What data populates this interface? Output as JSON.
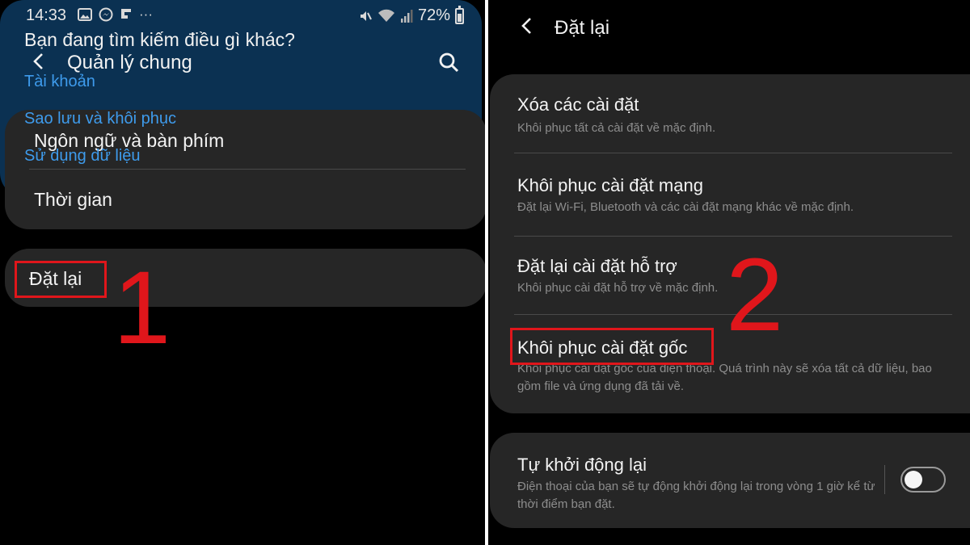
{
  "left": {
    "status_bar": {
      "time": "14:33",
      "battery": "72%",
      "battery_level": 0.72,
      "icons": [
        "gallery-icon",
        "messenger-icon",
        "flipboard-icon",
        "more-dots-icon",
        "mute-icon",
        "wifi-icon",
        "signal-icon",
        "battery-icon"
      ]
    },
    "header": {
      "title": "Quản lý chung"
    },
    "general_card": {
      "items": [
        {
          "label": "Ngôn ngữ và bàn phím"
        },
        {
          "label": "Thời gian"
        }
      ]
    },
    "reset_item": {
      "label": "Đặt lại"
    },
    "search_card": {
      "question": "Bạn đang tìm kiếm điều gì khác?",
      "links": [
        {
          "label": "Tài khoản"
        },
        {
          "label": "Sao lưu và khôi phục"
        },
        {
          "label": "Sử dụng dữ liệu"
        }
      ]
    },
    "annotation": "1"
  },
  "right": {
    "header": {
      "title": "Đặt lại"
    },
    "reset_options": [
      {
        "title": "Xóa các cài đặt",
        "subtitle": "Khôi phục tất cả cài đặt về mặc định."
      },
      {
        "title": "Khôi phục cài đặt mạng",
        "subtitle": "Đặt lại Wi-Fi, Bluetooth và các cài đặt mạng khác về mặc định."
      },
      {
        "title": "Đặt lại cài đặt hỗ trợ",
        "subtitle": "Khôi phục cài đặt hỗ trợ về mặc định."
      },
      {
        "title": "Khôi phục cài đặt gốc",
        "subtitle": "Khôi phục cài đặt gốc của điện thoại. Quá trình này sẽ xóa tất cả dữ liệu, bao gồm file và ứng dụng đã tải về."
      }
    ],
    "auto_restart": {
      "title": "Tự khởi động lại",
      "subtitle": "Điện thoại của bạn sẽ tự động khởi động lại trong vòng 1 giờ kể từ thời điểm bạn đặt.",
      "enabled": false
    },
    "annotation": "2"
  },
  "colors": {
    "background": "#000000",
    "card": "#262626",
    "search_card": "#0b3152",
    "link": "#3e9bec",
    "annotation_red": "#e0161b",
    "subtitle": "#8d8d8d"
  }
}
